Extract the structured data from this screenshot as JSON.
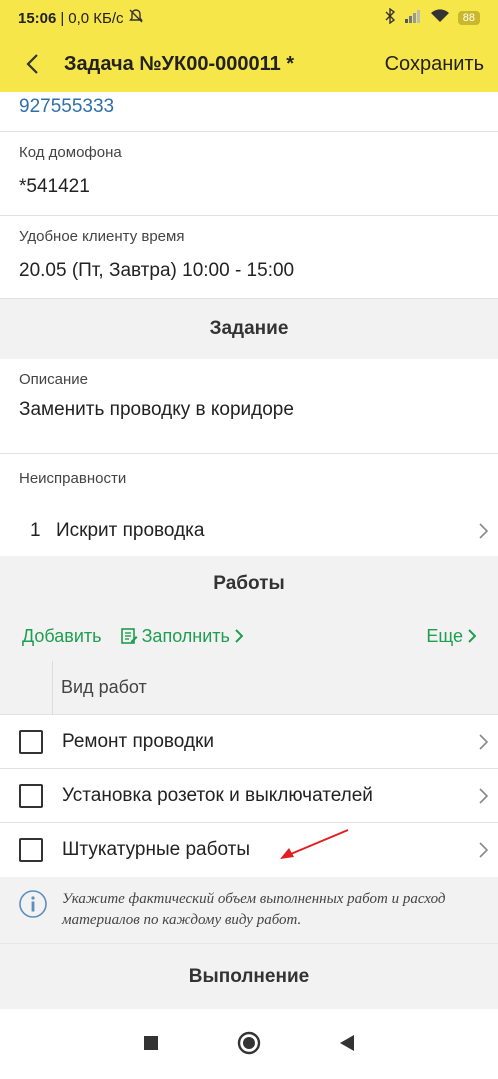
{
  "status_bar": {
    "time": "15:06",
    "separator": "|",
    "speed": "0,0 КБ/с",
    "battery": "88",
    "icons": [
      "mute-bell-icon",
      "bluetooth-icon",
      "signal-icon",
      "wifi-icon",
      "battery-icon"
    ]
  },
  "app_bar": {
    "title": "Задача №УК00-000011 *",
    "save_label": "Сохранить"
  },
  "contact": {
    "phone": "927555333",
    "intercom_label": "Код домофона",
    "intercom_value": "*541421",
    "time_label": "Удобное клиенту время",
    "time_value": "20.05 (Пт, Завтра)  10:00 - 15:00"
  },
  "task_section": {
    "header": "Задание",
    "description_label": "Описание",
    "description_value": "Заменить проводку в коридоре",
    "faults_label": "Неисправности",
    "faults": [
      {
        "num": "1",
        "text": "Искрит проводка"
      }
    ]
  },
  "works_section": {
    "header": "Работы",
    "add_label": "Добавить",
    "fill_label": "Заполнить",
    "more_label": "Еще",
    "column_header": "Вид работ",
    "items": [
      {
        "label": "Ремонт проводки",
        "checked": false
      },
      {
        "label": "Установка розеток и выключателей",
        "checked": false
      },
      {
        "label": "Штукатурные работы",
        "checked": false
      }
    ],
    "info_text": "Укажите фактический объем выполненных работ и расход материалов по каждому виду работ."
  },
  "execution_section": {
    "header": "Выполнение"
  },
  "colors": {
    "accent_yellow": "#f7e64a",
    "green": "#1e9e50",
    "link_blue": "#2f6fa8",
    "annotation_red": "#e02020"
  }
}
